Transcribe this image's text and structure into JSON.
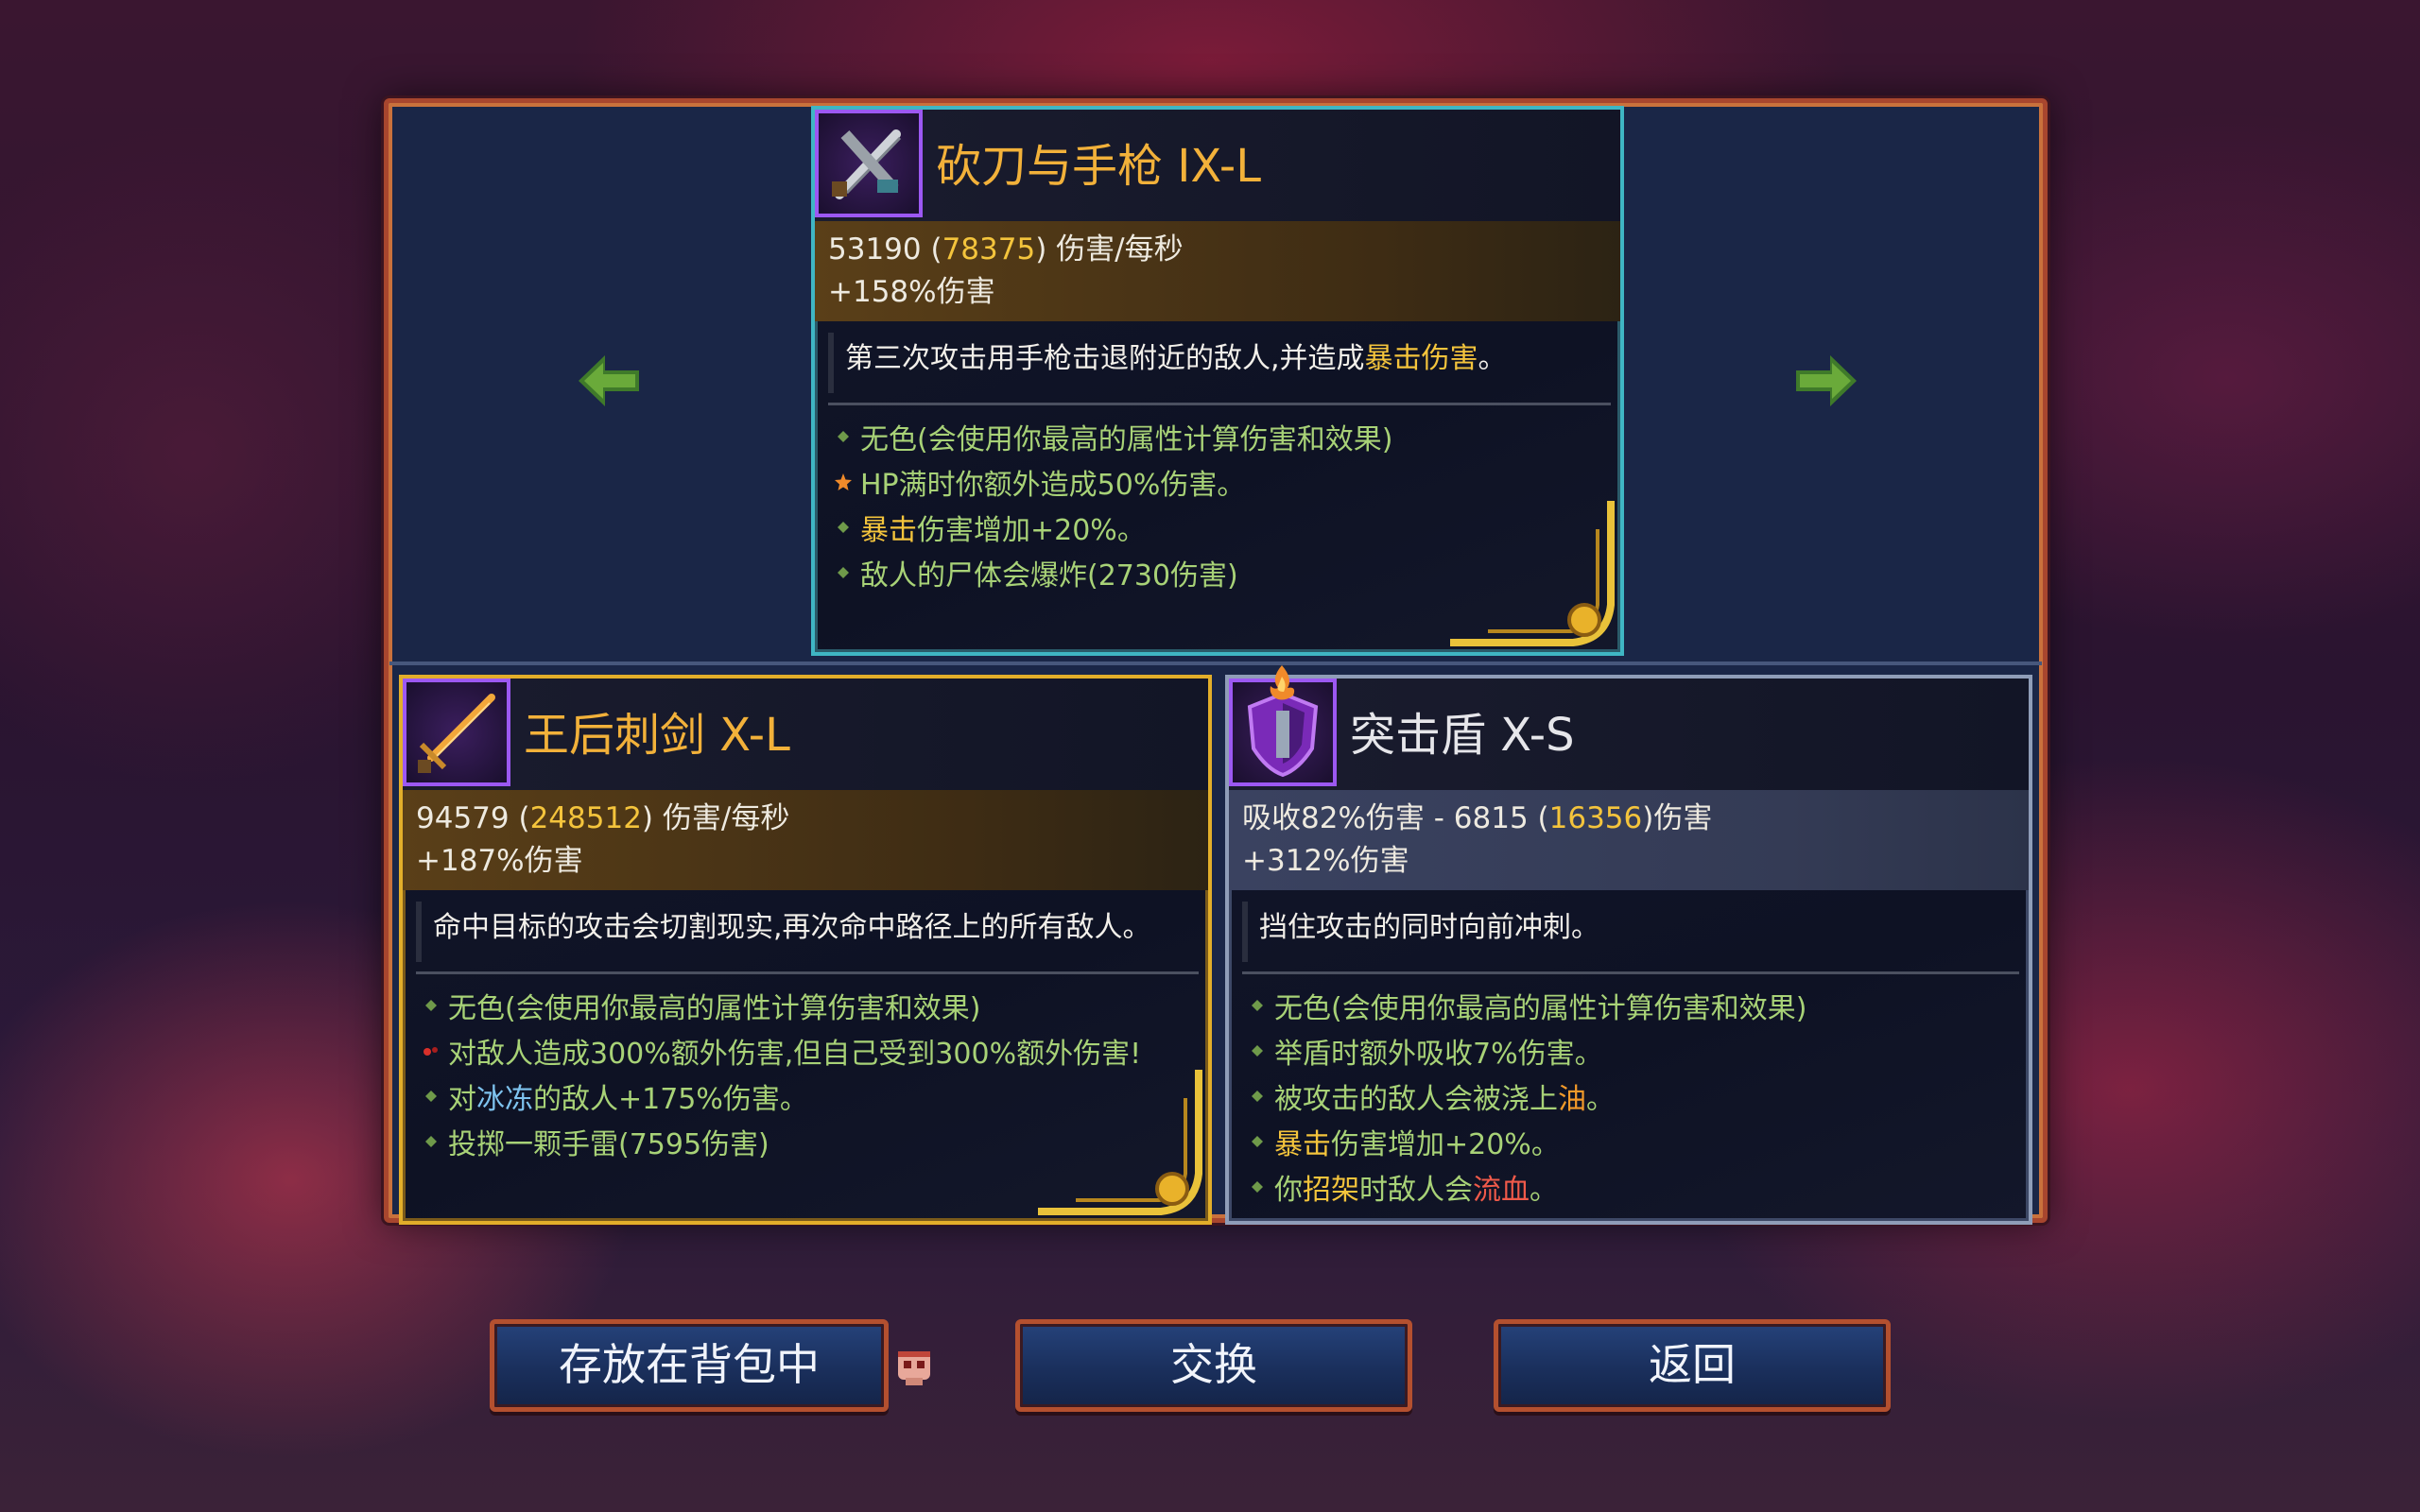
{
  "cards": {
    "top": {
      "title": "砍刀与手枪 IX-L",
      "dps_base": "53190 (",
      "dps_bonus": "78375",
      "dps_suffix": ") 伤害/每秒",
      "damage_bonus": "+158%伤害",
      "description_main": "第三次攻击用手枪击退附近的敌人,并造成",
      "description_highlight": "暴击伤害",
      "description_end": "。",
      "props": [
        "无色(会使用你最高的属性计算伤害和效果)",
        "HP满时你额外造成50%伤害。",
        "暴击",
        "伤害增加+20%。",
        "敌人的尸体会爆炸(2730伤害)"
      ]
    },
    "left": {
      "title": "王后刺剑 X-L",
      "dps_base": "94579 (",
      "dps_bonus": "248512",
      "dps_suffix": ") 伤害/每秒",
      "damage_bonus": "+187%伤害",
      "description": "命中目标的攻击会切割现实,再次命中路径上的所有敌人。",
      "props": [
        "无色(会使用你最高的属性计算伤害和效果)",
        "对敌人造成300%额外伤害,但自己受到300%额外伤害!",
        "对",
        "冰冻",
        "的敌人+175%伤害。",
        "投掷一颗手雷(7595伤害)"
      ]
    },
    "right": {
      "title": "突击盾 X-S",
      "stat_prefix": "吸收82%伤害 - 6815 (",
      "stat_bonus": "16356",
      "stat_suffix": ")伤害",
      "damage_bonus": "+312%伤害",
      "description": "挡住攻击的同时向前冲刺。",
      "props": [
        "无色(会使用你最高的属性计算伤害和效果)",
        "举盾时额外吸收7%伤害。",
        "被攻击的敌人会被浇上",
        "油",
        "。",
        "暴击",
        "伤害增加+20%。",
        "你",
        "招架",
        "时敌人会",
        "流血",
        "。"
      ]
    }
  },
  "buttons": {
    "store": "存放在背包中",
    "swap": "交换",
    "back": "返回"
  },
  "colors": {
    "gold": "#f4c43c",
    "prop_green": "#a8d277",
    "blue": "#7ec3ef",
    "orange": "#f39a2a",
    "red": "#f05a4a",
    "panel_border": "#c9713c"
  },
  "icons": [
    "left-arrow-icon",
    "right-arrow-icon",
    "cleaver-pistol-icon",
    "rapier-icon",
    "assault-shield-icon",
    "skull-icon",
    "star-bullet-icon",
    "blood-bullet-icon",
    "diamond-bullet-icon"
  ]
}
